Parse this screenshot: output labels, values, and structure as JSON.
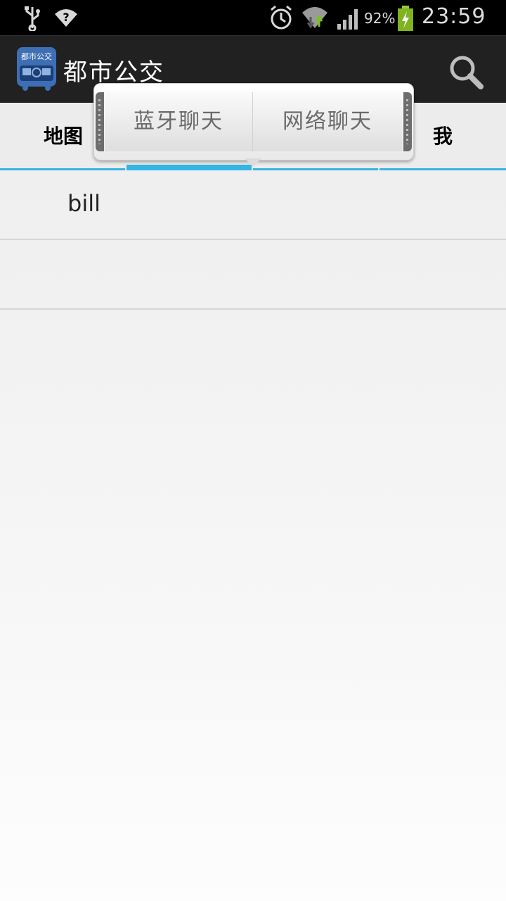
{
  "status_bar": {
    "battery_percent": "92%",
    "time": "23:59",
    "icons": [
      "usb-icon",
      "wifi-icon",
      "alarm-icon",
      "wifi-transfer-icon",
      "signal-icon",
      "battery-charging-icon"
    ]
  },
  "action_bar": {
    "title": "都市公交",
    "app_icon_text": "都市公交",
    "search_icon": "search-icon"
  },
  "tabs": {
    "items": [
      {
        "label": "地图"
      },
      {
        "label": ""
      },
      {
        "label": ""
      },
      {
        "label": "我"
      }
    ],
    "selected_index": 1,
    "accent_color": "#33b5e5"
  },
  "popup": {
    "items": [
      {
        "label": "蓝牙聊天"
      },
      {
        "label": "网络聊天"
      }
    ]
  },
  "list": {
    "rows": [
      {
        "text": "bill"
      },
      {
        "text": ""
      }
    ]
  }
}
